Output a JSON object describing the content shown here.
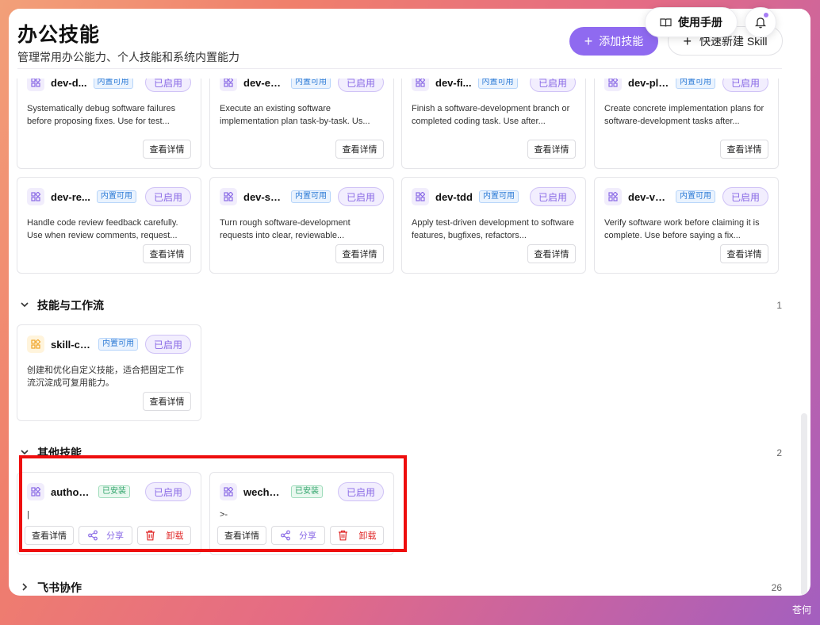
{
  "header": {
    "title": "办公技能",
    "subtitle": "管理常用办公能力、个人技能和系统内置能力",
    "add_label": "添加技能",
    "quick_label": "快速新建 Skill",
    "manual_label": "使用手册"
  },
  "labels": {
    "builtin": "内置可用",
    "installed": "已安装",
    "enabled": "已启用",
    "detail": "查看详情",
    "share": "分享",
    "uninstall": "卸载"
  },
  "dev_cards": [
    {
      "name": "dev-d...",
      "desc": "Systematically debug software failures before proposing fixes. Use for test..."
    },
    {
      "name": "dev-ex...",
      "desc": "Execute an existing software implementation plan task-by-task. Us..."
    },
    {
      "name": "dev-fi...",
      "desc": "Finish a software-development branch or completed coding task. Use after..."
    },
    {
      "name": "dev-plan",
      "desc": "Create concrete implementation plans for software-development tasks after..."
    },
    {
      "name": "dev-re...",
      "desc": "Handle code review feedback carefully. Use when review comments, request..."
    },
    {
      "name": "dev-sp...",
      "desc": "Turn rough software-development requests into clear, reviewable..."
    },
    {
      "name": "dev-tdd",
      "desc": "Apply test-driven development to software features, bugfixes, refactors..."
    },
    {
      "name": "dev-ve...",
      "desc": "Verify software work before claiming it is complete. Use before saying a fix..."
    }
  ],
  "sections": [
    {
      "title": "技能与工作流",
      "count": "1"
    },
    {
      "title": "其他技能",
      "count": "2"
    },
    {
      "title": "飞书协作",
      "count": "26"
    }
  ],
  "workflow_cards": [
    {
      "name": "skill-cr...",
      "desc": "创建和优化自定义技能，适合把固定工作流沉淀成可复用能力。"
    }
  ],
  "other_cards": [
    {
      "name": "author-...",
      "desc": "|"
    },
    {
      "name": "wechat-...",
      "desc": ">-"
    }
  ],
  "watermark": "苍何",
  "colors": {
    "accent": "#8f6af0",
    "highlight": "#ee0e0e",
    "danger": "#e02828"
  }
}
